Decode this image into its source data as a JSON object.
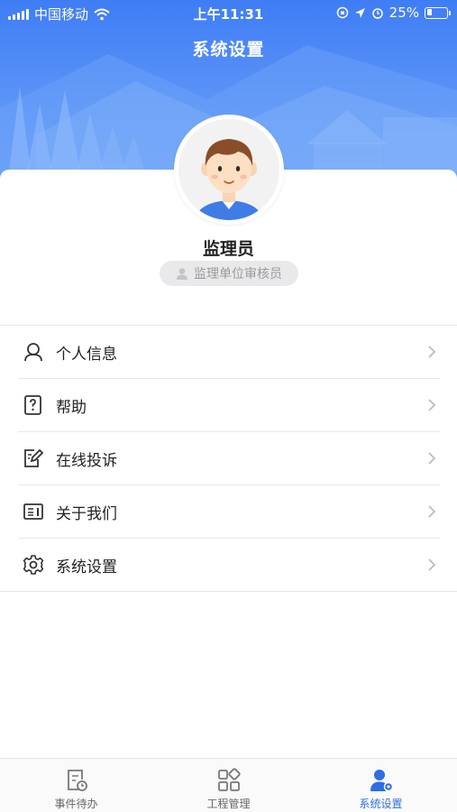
{
  "status_bar": {
    "carrier": "中国移动",
    "time": "上午11:31",
    "battery_percent": "25%",
    "battery_level": 0.25
  },
  "header": {
    "title": "系统设置"
  },
  "profile": {
    "name": "监理员",
    "role": "监理单位审核员"
  },
  "menu": {
    "items": [
      {
        "label": "个人信息",
        "icon": "user-outline-icon"
      },
      {
        "label": "帮助",
        "icon": "help-icon"
      },
      {
        "label": "在线投诉",
        "icon": "edit-icon"
      },
      {
        "label": "关于我们",
        "icon": "info-card-icon"
      },
      {
        "label": "系统设置",
        "icon": "gear-icon"
      }
    ]
  },
  "tabbar": {
    "tabs": [
      {
        "label": "事件待办",
        "icon": "todo-icon",
        "active": false
      },
      {
        "label": "工程管理",
        "icon": "grid-icon",
        "active": false
      },
      {
        "label": "系统设置",
        "icon": "user-settings-icon",
        "active": true
      }
    ],
    "active_color": "#2e6de6"
  },
  "colors": {
    "header_blue": "#3f7df5"
  }
}
